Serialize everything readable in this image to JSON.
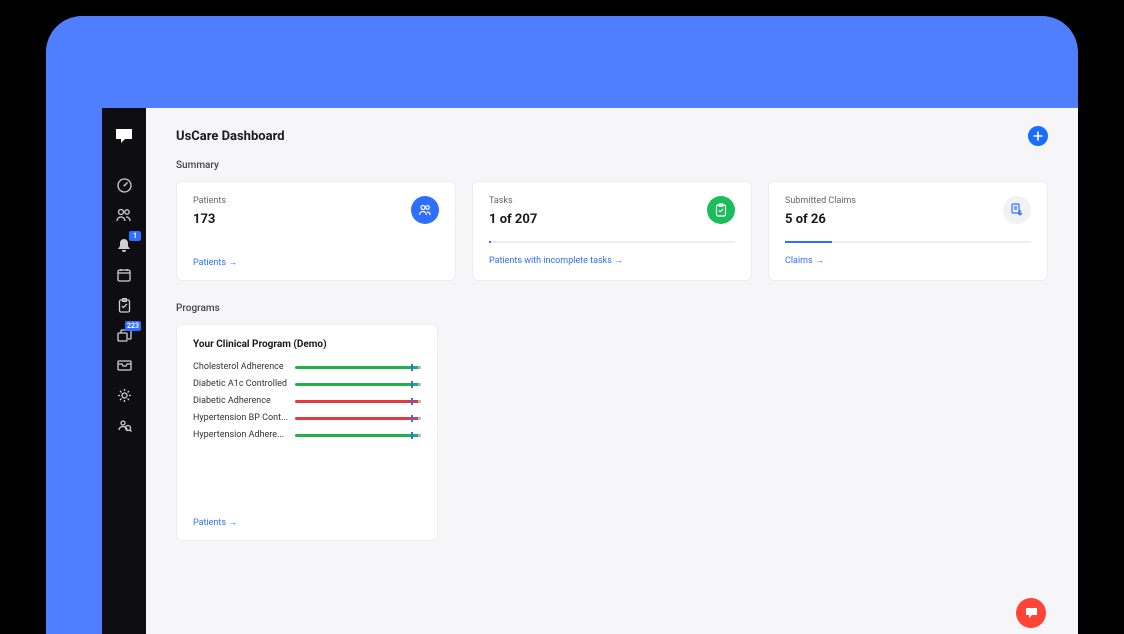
{
  "page": {
    "title": "UsCare Dashboard"
  },
  "sections": {
    "summary_label": "Summary",
    "programs_label": "Programs"
  },
  "summary": {
    "patients": {
      "label": "Patients",
      "value": "173",
      "link": "Patients →"
    },
    "tasks": {
      "label": "Tasks",
      "value": "1 of 207",
      "link": "Patients with incomplete tasks →",
      "progress_pct": 1
    },
    "claims": {
      "label": "Submitted Claims",
      "value": "5 of 26",
      "link": "Claims →",
      "progress_pct": 19
    }
  },
  "program": {
    "title": "Your Clinical Program (Demo)",
    "metrics": [
      {
        "label": "Cholesterol Adherence",
        "color": "green"
      },
      {
        "label": "Diabetic A1c Controlled",
        "color": "green"
      },
      {
        "label": "Diabetic Adherence",
        "color": "red"
      },
      {
        "label": "Hypertension BP Cont...",
        "color": "red"
      },
      {
        "label": "Hypertension Adhere...",
        "color": "green"
      }
    ],
    "link": "Patients →"
  },
  "sidebar_badges": {
    "bell": "1",
    "screen": "223"
  }
}
